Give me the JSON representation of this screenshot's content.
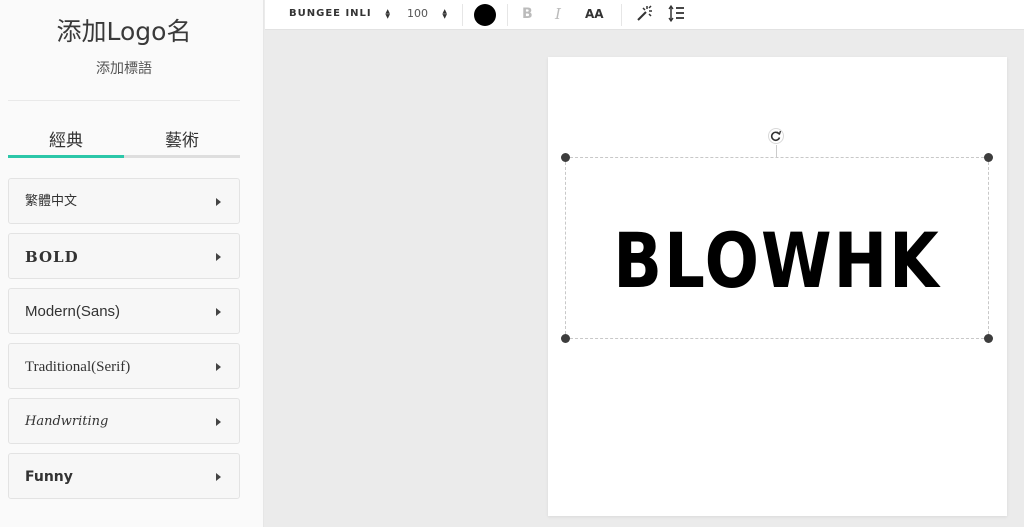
{
  "sidebar": {
    "logo_name": "添加Logo名",
    "logo_slogan": "添加標語",
    "tabs": [
      {
        "label": "經典",
        "active": true
      },
      {
        "label": "藝術",
        "active": false
      }
    ],
    "font_categories": [
      {
        "label": "繁體中文"
      },
      {
        "label": "BOLD"
      },
      {
        "label": "Modern(Sans)"
      },
      {
        "label": "Traditional(Serif)"
      },
      {
        "label": "Handwriting"
      },
      {
        "label": "Funny"
      }
    ]
  },
  "toolbar": {
    "font_family": "BUNGEE INLI",
    "font_size": "100",
    "text_color": "#000000",
    "bold_label": "B",
    "italic_label": "I",
    "case_label": "AA",
    "icons": [
      "text-effects-icon",
      "line-spacing-icon"
    ]
  },
  "canvas": {
    "logo_text": "BLOWHK",
    "text_color": "#000000"
  },
  "colors": {
    "accent": "#2cc7a9"
  }
}
